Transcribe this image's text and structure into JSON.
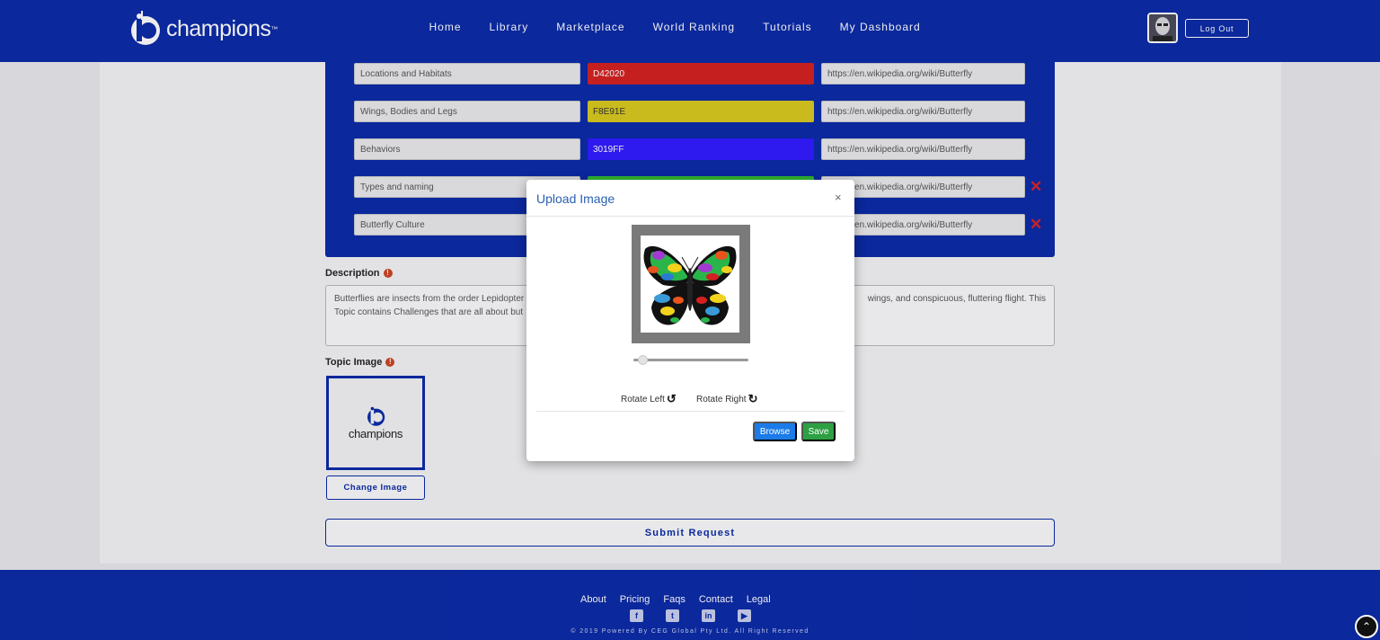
{
  "header": {
    "brand": "champions",
    "brand_tm": "™",
    "nav": [
      "Home",
      "Library",
      "Marketplace",
      "World Ranking",
      "Tutorials",
      "My Dashboard"
    ],
    "logout_label": "Log Out"
  },
  "resources": [
    {
      "name": "Locations and Habitats",
      "color_hex": "D42020",
      "color": "#d42020",
      "url": "https://en.wikipedia.org/wiki/Butterfly",
      "deletable": false
    },
    {
      "name": "Wings, Bodies and Legs",
      "color_hex": "F8E91E",
      "color": "#d8c81e",
      "url": "https://en.wikipedia.org/wiki/Butterfly",
      "deletable": false
    },
    {
      "name": "Behaviors",
      "color_hex": "3019FF",
      "color": "#3019ff",
      "url": "https://en.wikipedia.org/wiki/Butterfly",
      "deletable": false
    },
    {
      "name": "Types and naming",
      "color_hex": "",
      "color": "#30c030",
      "url": "https://en.wikipedia.org/wiki/Butterfly",
      "deletable": true
    },
    {
      "name": "Butterfly Culture",
      "color_hex": "",
      "color": "#30c030",
      "url": "https://en.wikipedia.org/wiki/Butterfly",
      "deletable": true
    }
  ],
  "description": {
    "label": "Description",
    "text_line1_start": "Butterflies are insects from the order Lepidopter",
    "text_line1_end": "wings, and conspicuous, fluttering flight. This",
    "text_line2": "Topic contains Challenges that are all about but"
  },
  "topic_image": {
    "label": "Topic Image",
    "logo_text": "champions",
    "change_label": "Change Image"
  },
  "submit_label": "Submit Request",
  "modal": {
    "title": "Upload Image",
    "close": "×",
    "zoom": 0.1,
    "rotate_left": "Rotate Left",
    "rotate_right": "Rotate Right",
    "browse_label": "Browse",
    "save_label": "Save"
  },
  "footer": {
    "links": [
      "About",
      "Pricing",
      "Faqs",
      "Contact",
      "Legal"
    ],
    "social_icons": [
      "facebook-icon",
      "twitter-icon",
      "linkedin-icon",
      "youtube-icon"
    ],
    "copyright": "© 2019 Powered By CEG Global Pty Ltd. All Right Reserved"
  },
  "colors": {
    "brand_blue": "#0a2aa6",
    "browse_blue": "#1a7be9",
    "save_green": "#2ea043",
    "delete_red": "#dd2222"
  }
}
